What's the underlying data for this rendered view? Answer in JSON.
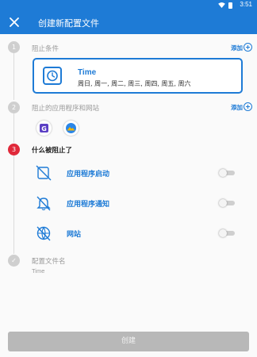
{
  "status_bar": {
    "time": "3:51"
  },
  "app_bar": {
    "title": "创建新配置文件",
    "close_icon": "close-icon"
  },
  "steps": [
    {
      "number": "1",
      "label": "阻止条件",
      "add_label": "添加"
    },
    {
      "number": "2",
      "label": "阻止的应用程序和网站",
      "add_label": "添加"
    },
    {
      "number": "3",
      "label": "什么被阻止了"
    },
    {
      "number": "✓",
      "label": "配置文件名",
      "subtitle": "Time"
    }
  ],
  "condition_card": {
    "name": "Time",
    "days": "周日, 周一, 周二, 周三, 周四, 周五, 周六"
  },
  "blocked_apps": [
    {
      "icon": "app-g-icon",
      "color": "#5b3fc4"
    },
    {
      "icon": "app-mountain-icon",
      "color": "#2a86e8"
    }
  ],
  "block_items": [
    {
      "label": "应用程序启动",
      "icon": "app-launch-blocked-icon",
      "enabled": false
    },
    {
      "label": "应用程序通知",
      "icon": "notification-off-icon",
      "enabled": false
    },
    {
      "label": "网站",
      "icon": "website-blocked-icon",
      "enabled": false
    }
  ],
  "create_button": {
    "label": "创建"
  },
  "colors": {
    "accent": "#1e7bd6",
    "step_active": "#e0293a",
    "disabled_button": "#b8b8b8"
  }
}
